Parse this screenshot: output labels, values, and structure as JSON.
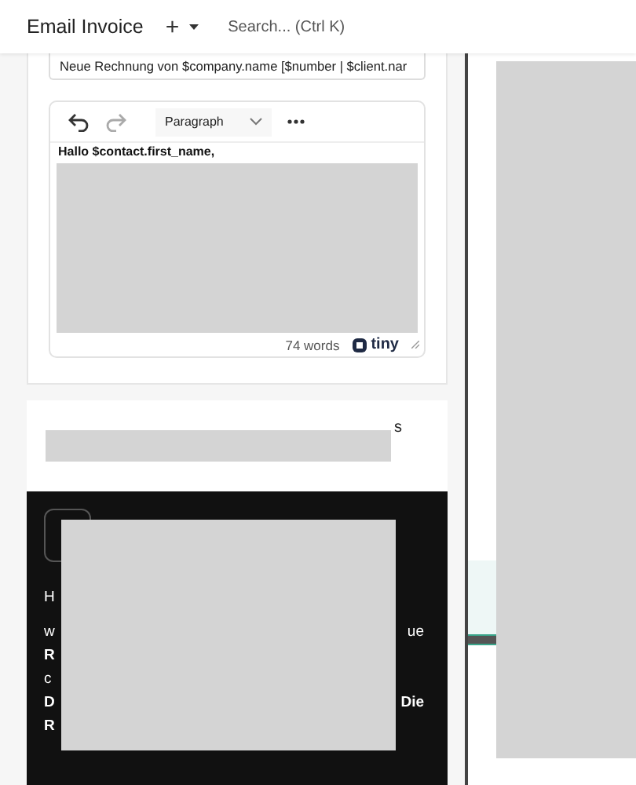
{
  "toolbar": {
    "title": "Email Invoice",
    "add_label": "+",
    "search": {
      "placeholder": "Search... (Ctrl K)"
    }
  },
  "editor": {
    "subject": "Neue Rechnung von $company.name [$number | $client.nar",
    "block_format": "Paragraph",
    "first_line": "Hallo $contact.first_name,",
    "word_count": "74 words",
    "brand": "tiny"
  },
  "preview": {
    "subject_fragment": "s",
    "body_lines": [
      {
        "left": "H",
        "bold": false
      },
      {
        "left": "w",
        "right": "ue",
        "bold": false
      },
      {
        "left": "R",
        "bold": true
      },
      {
        "left": "c",
        "bold": false
      },
      {
        "left": "D",
        "right": "Die",
        "bold": true
      },
      {
        "left": "R",
        "bold": true
      }
    ]
  }
}
